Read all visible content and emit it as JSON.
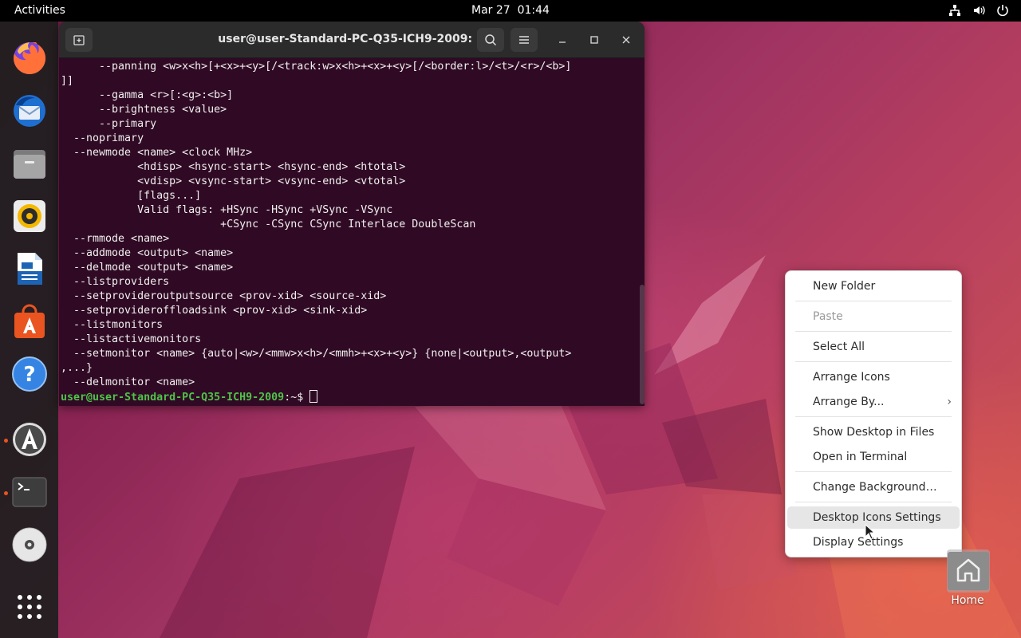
{
  "topbar": {
    "activities": "Activities",
    "date": "Mar 27",
    "time": "01:44",
    "tray_icons": [
      "network-icon",
      "volume-icon",
      "power-icon"
    ]
  },
  "dock": {
    "apps": [
      {
        "name": "firefox",
        "running": false
      },
      {
        "name": "thunderbird",
        "running": false
      },
      {
        "name": "files",
        "running": false
      },
      {
        "name": "rhythmbox",
        "running": false
      },
      {
        "name": "libreoffice-writer",
        "running": false
      },
      {
        "name": "app-center",
        "running": false
      },
      {
        "name": "help",
        "running": false
      },
      {
        "name": "software-updater",
        "running": true
      },
      {
        "name": "terminal",
        "running": true
      },
      {
        "name": "disc",
        "running": false
      },
      {
        "name": "show-apps",
        "running": false
      }
    ]
  },
  "terminal": {
    "title": "user@user-Standard-PC-Q35-ICH9-2009: ~",
    "lines": [
      "      --panning <w>x<h>[+<x>+<y>[/<track:w>x<h>+<x>+<y>[/<border:l>/<t>/<r>/<b>]",
      "]]",
      "      --gamma <r>[:<g>:<b>]",
      "      --brightness <value>",
      "      --primary",
      "  --noprimary",
      "  --newmode <name> <clock MHz>",
      "            <hdisp> <hsync-start> <hsync-end> <htotal>",
      "            <vdisp> <vsync-start> <vsync-end> <vtotal>",
      "            [flags...]",
      "            Valid flags: +HSync -HSync +VSync -VSync",
      "                         +CSync -CSync CSync Interlace DoubleScan",
      "  --rmmode <name>",
      "  --addmode <output> <name>",
      "  --delmode <output> <name>",
      "  --listproviders",
      "  --setprovideroutputsource <prov-xid> <source-xid>",
      "  --setprovideroffloadsink <prov-xid> <sink-xid>",
      "  --listmonitors",
      "  --listactivemonitors",
      "  --setmonitor <name> {auto|<w>/<mmw>x<h>/<mmh>+<x>+<y>} {none|<output>,<output>",
      ",...}",
      "  --delmonitor <name>"
    ],
    "prompt_user": "user@user-Standard-PC-Q35-ICH9-2009",
    "prompt_suffix": ":~$ "
  },
  "context_menu": {
    "new_folder": "New Folder",
    "paste": "Paste",
    "select_all": "Select All",
    "arrange_icons": "Arrange Icons",
    "arrange_by": "Arrange By...",
    "show_desktop_in_files": "Show Desktop in Files",
    "open_in_terminal": "Open in Terminal",
    "change_background": "Change Background…",
    "desktop_icons_settings": "Desktop Icons Settings",
    "display_settings": "Display Settings"
  },
  "desktop": {
    "home_label": "Home"
  }
}
